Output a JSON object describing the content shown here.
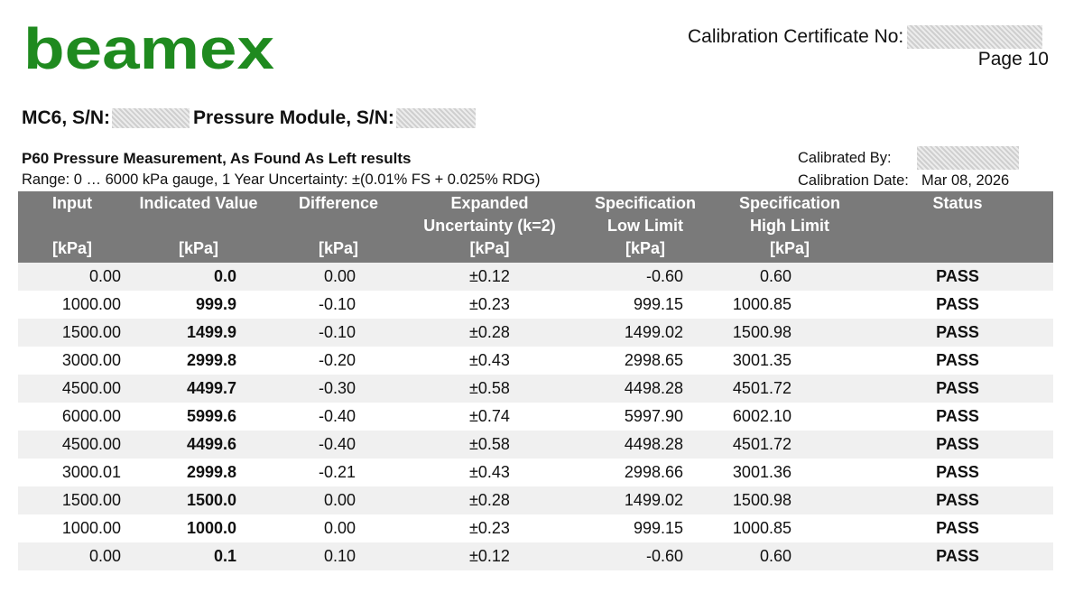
{
  "logo": {
    "text": "beamex",
    "color": "#1f8a1f"
  },
  "header": {
    "certificate_label": "Calibration Certificate No:",
    "page_label": "Page 10"
  },
  "device": {
    "instrument_label": "MC6, S/N:",
    "module_label": "Pressure Module, S/N:"
  },
  "procedure": {
    "title": "P60 Pressure Measurement, As Found As Left results",
    "range": "Range: 0 … 6000 kPa gauge, 1 Year Uncertainty: ±(0.01% FS + 0.025% RDG)",
    "calibrated_by_label": "Calibrated By:",
    "calibration_date_label": "Calibration Date:",
    "calibration_date": "Mar 08, 2026"
  },
  "table": {
    "header_bg": "#7a7a7a",
    "stripe_bg": "#f0f0f0",
    "columns": [
      {
        "l1": "Input",
        "l2": "",
        "l3": "[kPa]"
      },
      {
        "l1": "Indicated Value",
        "l2": "",
        "l3": "[kPa]"
      },
      {
        "l1": "Difference",
        "l2": "",
        "l3": "[kPa]"
      },
      {
        "l1": "Expanded",
        "l2": "Uncertainty (k=2)",
        "l3": "[kPa]"
      },
      {
        "l1": "Specification",
        "l2": "Low Limit",
        "l3": "[kPa]"
      },
      {
        "l1": "Specification",
        "l2": "High Limit",
        "l3": "[kPa]"
      },
      {
        "l1": "Status",
        "l2": "",
        "l3": ""
      }
    ],
    "rows": [
      {
        "input": "0.00",
        "indicated": "0.0",
        "difference": "0.00",
        "uncertainty": "±0.12",
        "low": "-0.60",
        "high": "0.60",
        "status": "PASS"
      },
      {
        "input": "1000.00",
        "indicated": "999.9",
        "difference": "-0.10",
        "uncertainty": "±0.23",
        "low": "999.15",
        "high": "1000.85",
        "status": "PASS"
      },
      {
        "input": "1500.00",
        "indicated": "1499.9",
        "difference": "-0.10",
        "uncertainty": "±0.28",
        "low": "1499.02",
        "high": "1500.98",
        "status": "PASS"
      },
      {
        "input": "3000.00",
        "indicated": "2999.8",
        "difference": "-0.20",
        "uncertainty": "±0.43",
        "low": "2998.65",
        "high": "3001.35",
        "status": "PASS"
      },
      {
        "input": "4500.00",
        "indicated": "4499.7",
        "difference": "-0.30",
        "uncertainty": "±0.58",
        "low": "4498.28",
        "high": "4501.72",
        "status": "PASS"
      },
      {
        "input": "6000.00",
        "indicated": "5999.6",
        "difference": "-0.40",
        "uncertainty": "±0.74",
        "low": "5997.90",
        "high": "6002.10",
        "status": "PASS"
      },
      {
        "input": "4500.00",
        "indicated": "4499.6",
        "difference": "-0.40",
        "uncertainty": "±0.58",
        "low": "4498.28",
        "high": "4501.72",
        "status": "PASS"
      },
      {
        "input": "3000.01",
        "indicated": "2999.8",
        "difference": "-0.21",
        "uncertainty": "±0.43",
        "low": "2998.66",
        "high": "3001.36",
        "status": "PASS"
      },
      {
        "input": "1500.00",
        "indicated": "1500.0",
        "difference": "0.00",
        "uncertainty": "±0.28",
        "low": "1499.02",
        "high": "1500.98",
        "status": "PASS"
      },
      {
        "input": "1000.00",
        "indicated": "1000.0",
        "difference": "0.00",
        "uncertainty": "±0.23",
        "low": "999.15",
        "high": "1000.85",
        "status": "PASS"
      },
      {
        "input": "0.00",
        "indicated": "0.1",
        "difference": "0.10",
        "uncertainty": "±0.12",
        "low": "-0.60",
        "high": "0.60",
        "status": "PASS"
      }
    ]
  }
}
